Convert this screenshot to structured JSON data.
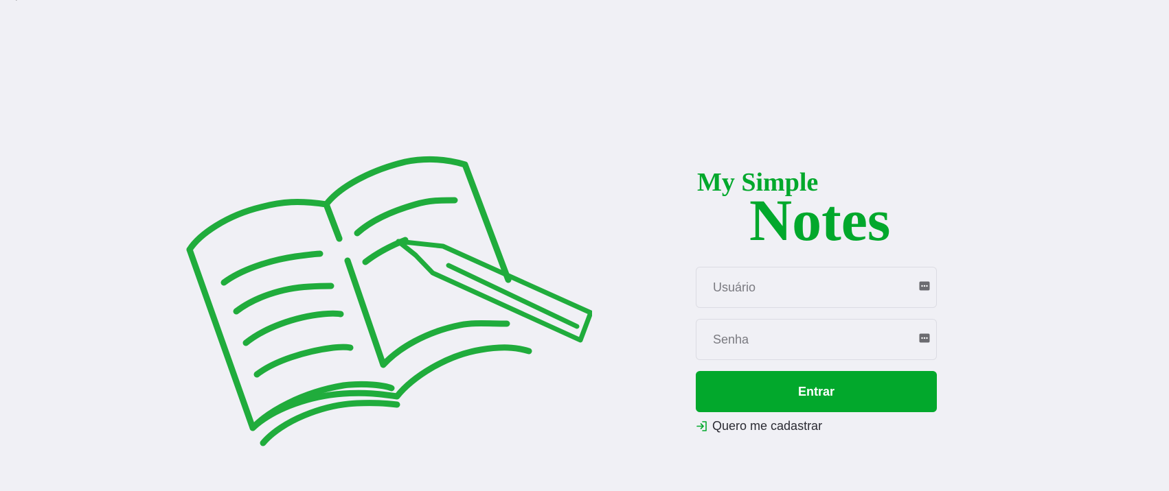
{
  "brand": {
    "logo_line1": "My Simple",
    "logo_line2": "Notes",
    "color": "#02a82c"
  },
  "hero": {
    "icon": "open-book-with-pencil-illustration"
  },
  "form": {
    "username": {
      "placeholder": "Usuário",
      "value": "",
      "icon": "keychain-icon"
    },
    "password": {
      "placeholder": "Senha",
      "value": "",
      "icon": "keychain-icon"
    },
    "submit_label": "Entrar"
  },
  "register": {
    "label": "Quero me cadastrar",
    "icon": "login-icon"
  },
  "colors": {
    "background": "#f0f0f5",
    "primary": "#02a82c",
    "illustration": "#20ac3c",
    "text": "#2b2b33"
  }
}
